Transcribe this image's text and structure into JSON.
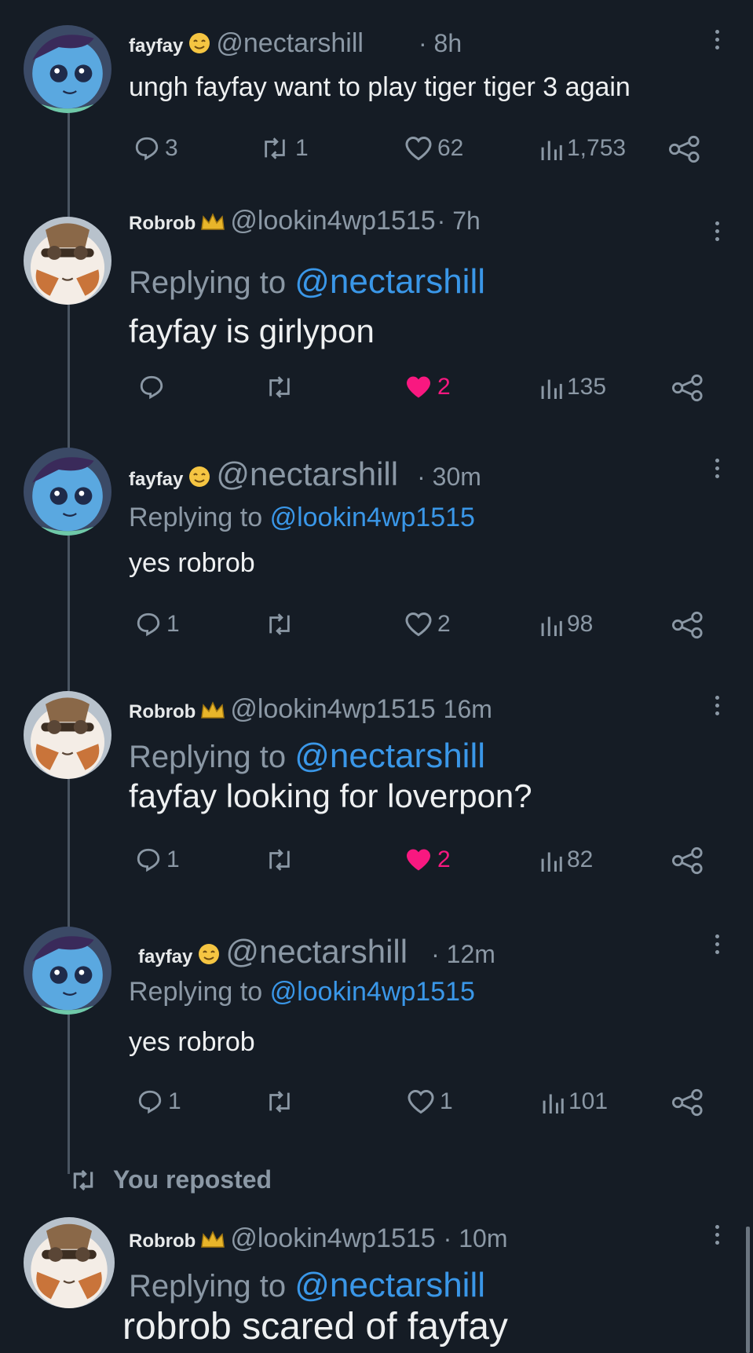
{
  "colors": {
    "background": "#151c25",
    "muted": "#8b98a5",
    "mention": "#3a97e8",
    "like": "#f91880"
  },
  "tweets": [
    {
      "name": "fayfay",
      "badge": "smiling-face-emoji",
      "handle": "@nectarshill",
      "time": "· 8h",
      "reply_prefix": "",
      "reply_to": "",
      "text": "ungh fayfay want to play tiger tiger 3 again",
      "replies": "3",
      "reposts": "1",
      "likes": "62",
      "liked": false,
      "views": "1,753"
    },
    {
      "name": "Robrob",
      "badge": "crown-emoji",
      "handle": "@lookin4wp1515",
      "time": "· 7h",
      "reply_prefix": "Replying to",
      "reply_to": "@nectarshill",
      "text": "fayfay is girlypon",
      "replies": "",
      "reposts": "",
      "likes": "2",
      "liked": true,
      "views": "135"
    },
    {
      "name": "fayfay",
      "badge": "smiling-face-emoji",
      "handle": "@nectarshill",
      "time": "· 30m",
      "reply_prefix": "Replying to",
      "reply_to": "@lookin4wp1515",
      "text": "yes robrob",
      "replies": "1",
      "reposts": "",
      "likes": "2",
      "liked": false,
      "views": "98"
    },
    {
      "name": "Robrob",
      "badge": "crown-emoji",
      "handle": "@lookin4wp1515",
      "time": "16m",
      "reply_prefix": "Replying to",
      "reply_to": "@nectarshill",
      "text": "fayfay looking for loverpon?",
      "replies": "1",
      "reposts": "",
      "likes": "2",
      "liked": true,
      "views": "82"
    },
    {
      "name": "fayfay",
      "badge": "smiling-face-emoji",
      "handle": "@nectarshill",
      "time": "· 12m",
      "reply_prefix": "Replying to",
      "reply_to": "@lookin4wp1515",
      "text": "yes robrob",
      "replies": "1",
      "reposts": "",
      "likes": "1",
      "liked": false,
      "views": "101"
    },
    {
      "name": "Robrob",
      "badge": "crown-emoji",
      "handle": "@lookin4wp1515",
      "time": "· 10m",
      "reply_prefix": "Replying to",
      "reply_to": "@nectarshill",
      "text": "robrob scared of fayfay"
    }
  ],
  "repost_banner": {
    "label": "You reposted"
  }
}
